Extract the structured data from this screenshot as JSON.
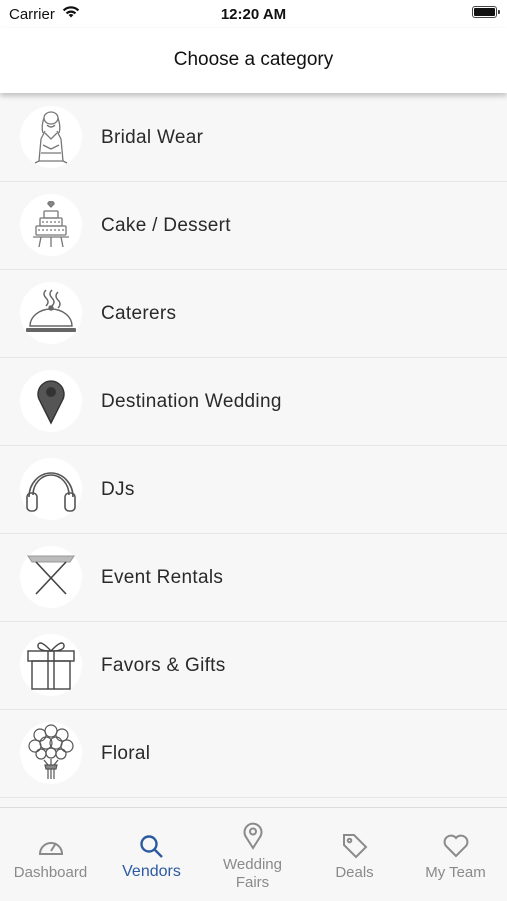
{
  "status_bar": {
    "carrier": "Carrier",
    "time": "12:20 AM"
  },
  "header": {
    "title": "Choose a category"
  },
  "categories": [
    {
      "label": "Bridal Wear",
      "icon": "bridal-dress-icon"
    },
    {
      "label": "Cake / Dessert",
      "icon": "cake-icon"
    },
    {
      "label": "Caterers",
      "icon": "cloche-icon"
    },
    {
      "label": "Destination Wedding",
      "icon": "location-pin-icon"
    },
    {
      "label": "DJs",
      "icon": "headphones-icon"
    },
    {
      "label": "Event Rentals",
      "icon": "folding-table-icon"
    },
    {
      "label": "Favors & Gifts",
      "icon": "gift-box-icon"
    },
    {
      "label": "Floral",
      "icon": "flower-bouquet-icon"
    }
  ],
  "tab_bar": {
    "tabs": [
      {
        "label": "Dashboard",
        "icon": "speedometer-icon"
      },
      {
        "label": "Vendors",
        "icon": "search-icon",
        "active": true
      },
      {
        "label_line1": "Wedding",
        "label_line2": "Fairs",
        "icon": "location-pin-icon"
      },
      {
        "label": "Deals",
        "icon": "tag-icon"
      },
      {
        "label": "My Team",
        "icon": "heart-icon"
      }
    ]
  },
  "colors": {
    "active_tab": "#2c5aa0",
    "inactive_tab": "#8a8a8a",
    "background": "#f7f7f7"
  }
}
